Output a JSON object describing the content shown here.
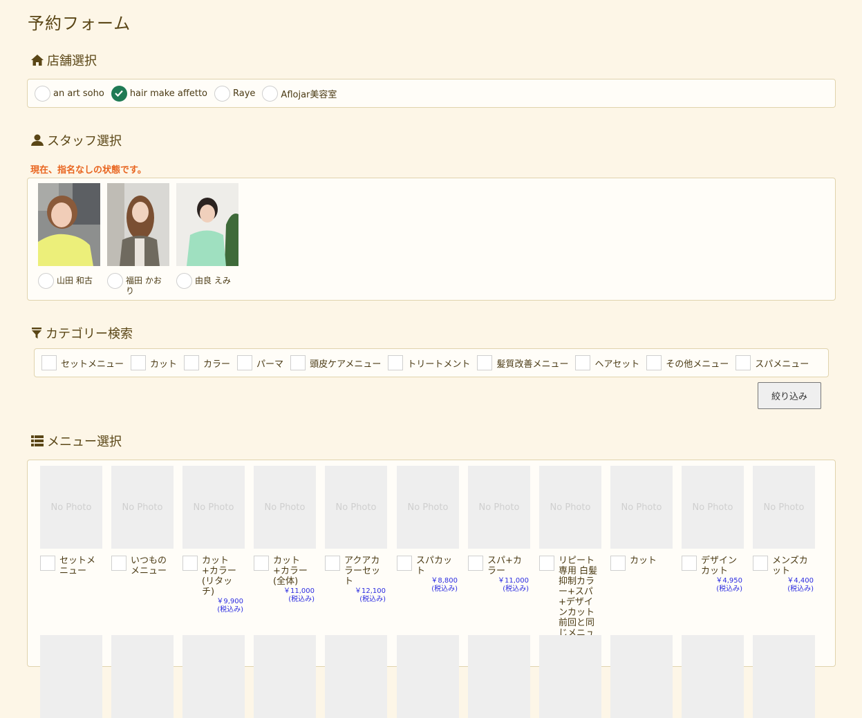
{
  "page": {
    "title": "予約フォーム"
  },
  "store_section": {
    "heading": "店舗選択",
    "icon": "home-icon",
    "options": [
      {
        "label": "an art soho",
        "checked": false
      },
      {
        "label": "hair make affetto",
        "checked": true
      },
      {
        "label": "Raye",
        "checked": false
      },
      {
        "label": "Aflojar美容室",
        "checked": false
      }
    ]
  },
  "staff_section": {
    "heading": "スタッフ選択",
    "icon": "user-icon",
    "notice": "現在、指名なしの状態です。",
    "staff": [
      {
        "name": "山田 和古",
        "photo": "staff-photo-yamada",
        "checked": false
      },
      {
        "name": "福田 かおり",
        "photo": "staff-photo-fukuda",
        "checked": false
      },
      {
        "name": "由良 えみ",
        "photo": "staff-photo-yura",
        "checked": false
      }
    ]
  },
  "category_section": {
    "heading": "カテゴリー検索",
    "icon": "filter-icon",
    "categories": [
      "セットメニュー",
      "カット",
      "カラー",
      "パーマ",
      "頭皮ケアメニュー",
      "トリートメント",
      "髪質改善メニュー",
      "ヘアセット",
      "その他メニュー",
      "スパメニュー"
    ],
    "filter_button": "絞り込み"
  },
  "menu_section": {
    "heading": "メニュー選択",
    "icon": "list-icon",
    "no_photo": "No Photo",
    "tax_note": "(税込み)",
    "items": [
      {
        "name": "セットメニュー",
        "price": ""
      },
      {
        "name": "いつものメニュー",
        "price": ""
      },
      {
        "name": "カット+カラー(リタッチ)",
        "price": "￥9,900"
      },
      {
        "name": "カット+カラー(全体)",
        "price": "￥11,000"
      },
      {
        "name": "アクアカラーセット",
        "price": "￥12,100"
      },
      {
        "name": "スパカット",
        "price": "￥8,800"
      },
      {
        "name": "スパ+カラー",
        "price": "￥11,000"
      },
      {
        "name": "リピート専用 白髪抑制カラー+スパ+デザインカット前回と同じメニュー",
        "price": ""
      },
      {
        "name": "カット",
        "price": ""
      },
      {
        "name": "デザインカット",
        "price": "￥4,950"
      },
      {
        "name": "メンズカット",
        "price": "￥4,400"
      }
    ]
  },
  "colors": {
    "background": "#fdf6e7",
    "accent_checked": "#1f7a55",
    "notice": "#e8641e",
    "price": "#2a2ae0"
  }
}
